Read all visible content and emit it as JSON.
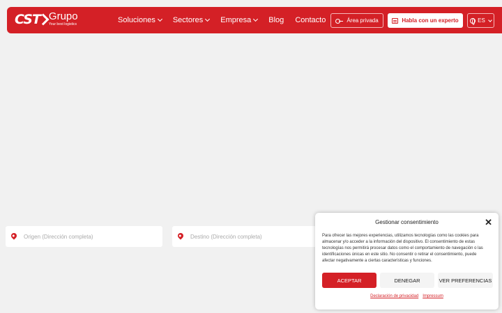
{
  "header": {
    "logo": {
      "brand": "CST",
      "name": "Grupo",
      "tagline": "Your best logistics"
    },
    "nav": [
      {
        "label": "Soluciones",
        "dropdown": true
      },
      {
        "label": "Sectores",
        "dropdown": true
      },
      {
        "label": "Empresa",
        "dropdown": true
      },
      {
        "label": "Blog",
        "dropdown": false
      },
      {
        "label": "Contacto",
        "dropdown": false
      }
    ],
    "private_area_label": "Área privada",
    "expert_label": "Habla con un experto",
    "language": "ES",
    "brand_color": "#d42026"
  },
  "search": {
    "origin_placeholder": "Origen (Dirección completa)",
    "destination_placeholder": "Destino (Dirección completa)"
  },
  "consent": {
    "title": "Gestionar consentimiento",
    "close": "✕",
    "text": "Para ofrecer las mejores experiencias, utilizamos tecnologías como las cookies para almacenar y/o acceder a la información del dispositivo. El consentimiento de estas tecnologías nos permitirá procesar datos como el comportamiento de navegación o las identificaciones únicas en este sitio. No consentir o retirar el consentimiento, puede afectar negativamente a ciertas características y funciones.",
    "accept_label": "ACEPTAR",
    "deny_label": "DENEGAR",
    "prefs_label": "VER PREFERENCIAS",
    "privacy_link": "Declaración de privacidad",
    "impressum_link": "Impressum"
  }
}
